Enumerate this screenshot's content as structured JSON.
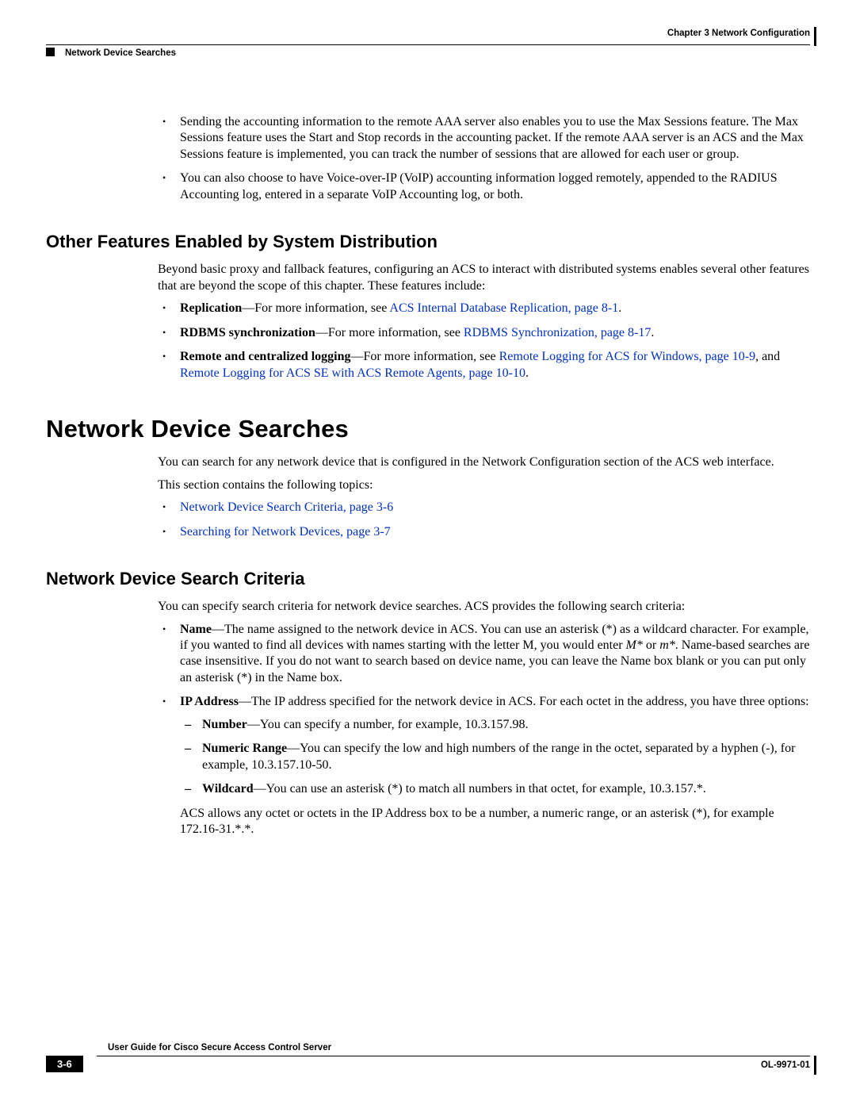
{
  "header": {
    "chapter": "Chapter 3      Network Configuration",
    "section": "Network Device Searches"
  },
  "intro_bullets": [
    "Sending the accounting information to the remote AAA server also enables you to use the Max Sessions feature. The Max Sessions feature uses the Start and Stop records in the accounting packet. If the remote AAA server is an ACS and the Max Sessions feature is implemented, you can track the number of sessions that are allowed for each user or group.",
    "You can also choose to have Voice-over-IP (VoIP) accounting information logged remotely, appended to the RADIUS Accounting log, entered in a separate VoIP Accounting log, or both."
  ],
  "section1": {
    "title": "Other Features Enabled by System Distribution",
    "para": "Beyond basic proxy and fallback features, configuring an ACS to interact with distributed systems enables several other features that are beyond the scope of this chapter. These features include:",
    "items": [
      {
        "bold": "Replication",
        "mid": "—For more information, see ",
        "link": "ACS Internal Database Replication, page 8-1",
        "after": "."
      },
      {
        "bold": "RDBMS synchronization",
        "mid": "—For more information, see ",
        "link": "RDBMS Synchronization, page 8-17",
        "after": "."
      },
      {
        "bold": "Remote and centralized logging",
        "mid": "—For more information, see ",
        "link": "Remote Logging for ACS for Windows, page 10-9",
        "after2": ", and ",
        "link2": "Remote Logging for ACS SE with ACS Remote Agents, page 10-10",
        "after": "."
      }
    ]
  },
  "section2": {
    "title": "Network Device Searches",
    "para1": "You can search for any network device that is configured in the Network Configuration section of the ACS web interface.",
    "para2": "This section contains the following topics:",
    "links": [
      "Network Device Search Criteria, page 3-6",
      "Searching for Network Devices, page 3-7"
    ]
  },
  "section3": {
    "title": "Network Device Search Criteria",
    "para": "You can specify search criteria for network device searches. ACS provides the following search criteria:",
    "name_item": {
      "bold": "Name",
      "text1": "—The name assigned to the network device in ACS. You can use an asterisk (*) as a wildcard character. For example, if you wanted to find all devices with names starting with the letter M, you would enter ",
      "italic1": "M*",
      "text2": " or ",
      "italic2": "m*",
      "text3": ". Name-based searches are case insensitive. If you do not want to search based on device name, you can leave the Name box blank or you can put only an asterisk (*) in the Name box."
    },
    "ip_item": {
      "bold": "IP Address",
      "text": "—The IP address specified for the network device in ACS. For each octet in the address, you have three options:",
      "subs": [
        {
          "bold": "Number",
          "text": "—You can specify a number, for example, 10.3.157.98."
        },
        {
          "bold": "Numeric Range",
          "text": "—You can specify the low and high numbers of the range in the octet, separated by a hyphen (-), for example, 10.3.157.10-50."
        },
        {
          "bold": "Wildcard",
          "text": "—You can use an asterisk (*) to match all numbers in that octet, for example, 10.3.157.*."
        }
      ],
      "closing": "ACS allows any octet or octets in the IP Address box to be a number, a numeric range, or an asterisk (*), for example 172.16-31.*.*."
    }
  },
  "footer": {
    "book": "User Guide for Cisco Secure Access Control Server",
    "page": "3-6",
    "code": "OL-9971-01"
  }
}
